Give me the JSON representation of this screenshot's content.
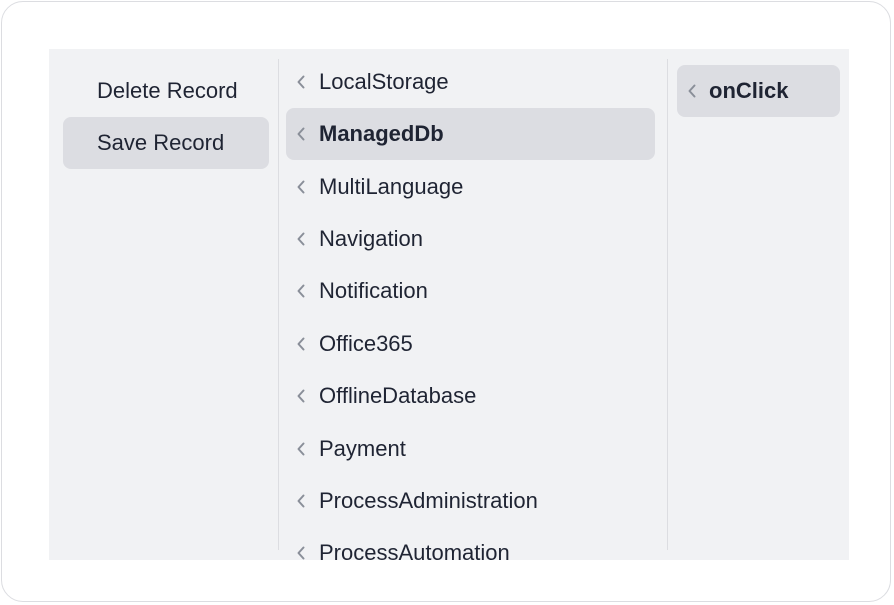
{
  "left_menu": {
    "items": [
      {
        "label": "Delete Record"
      },
      {
        "label": "Save Record"
      }
    ],
    "active_index": 1
  },
  "middle_menu": {
    "items": [
      {
        "label": "LocalStorage"
      },
      {
        "label": "ManagedDb"
      },
      {
        "label": "MultiLanguage"
      },
      {
        "label": "Navigation"
      },
      {
        "label": "Notification"
      },
      {
        "label": "Office365"
      },
      {
        "label": "OfflineDatabase"
      },
      {
        "label": "Payment"
      },
      {
        "label": "ProcessAdministration"
      },
      {
        "label": "ProcessAutomation"
      }
    ],
    "active_index": 1
  },
  "right_menu": {
    "items": [
      {
        "label": "onClick"
      }
    ]
  },
  "icons": {
    "item_chevron": "chevron-left-icon"
  },
  "colors": {
    "panel_background": "#f1f2f4",
    "active_background": "#dcdde2",
    "text": "#1f2433",
    "chevron": "#8a8f99"
  }
}
